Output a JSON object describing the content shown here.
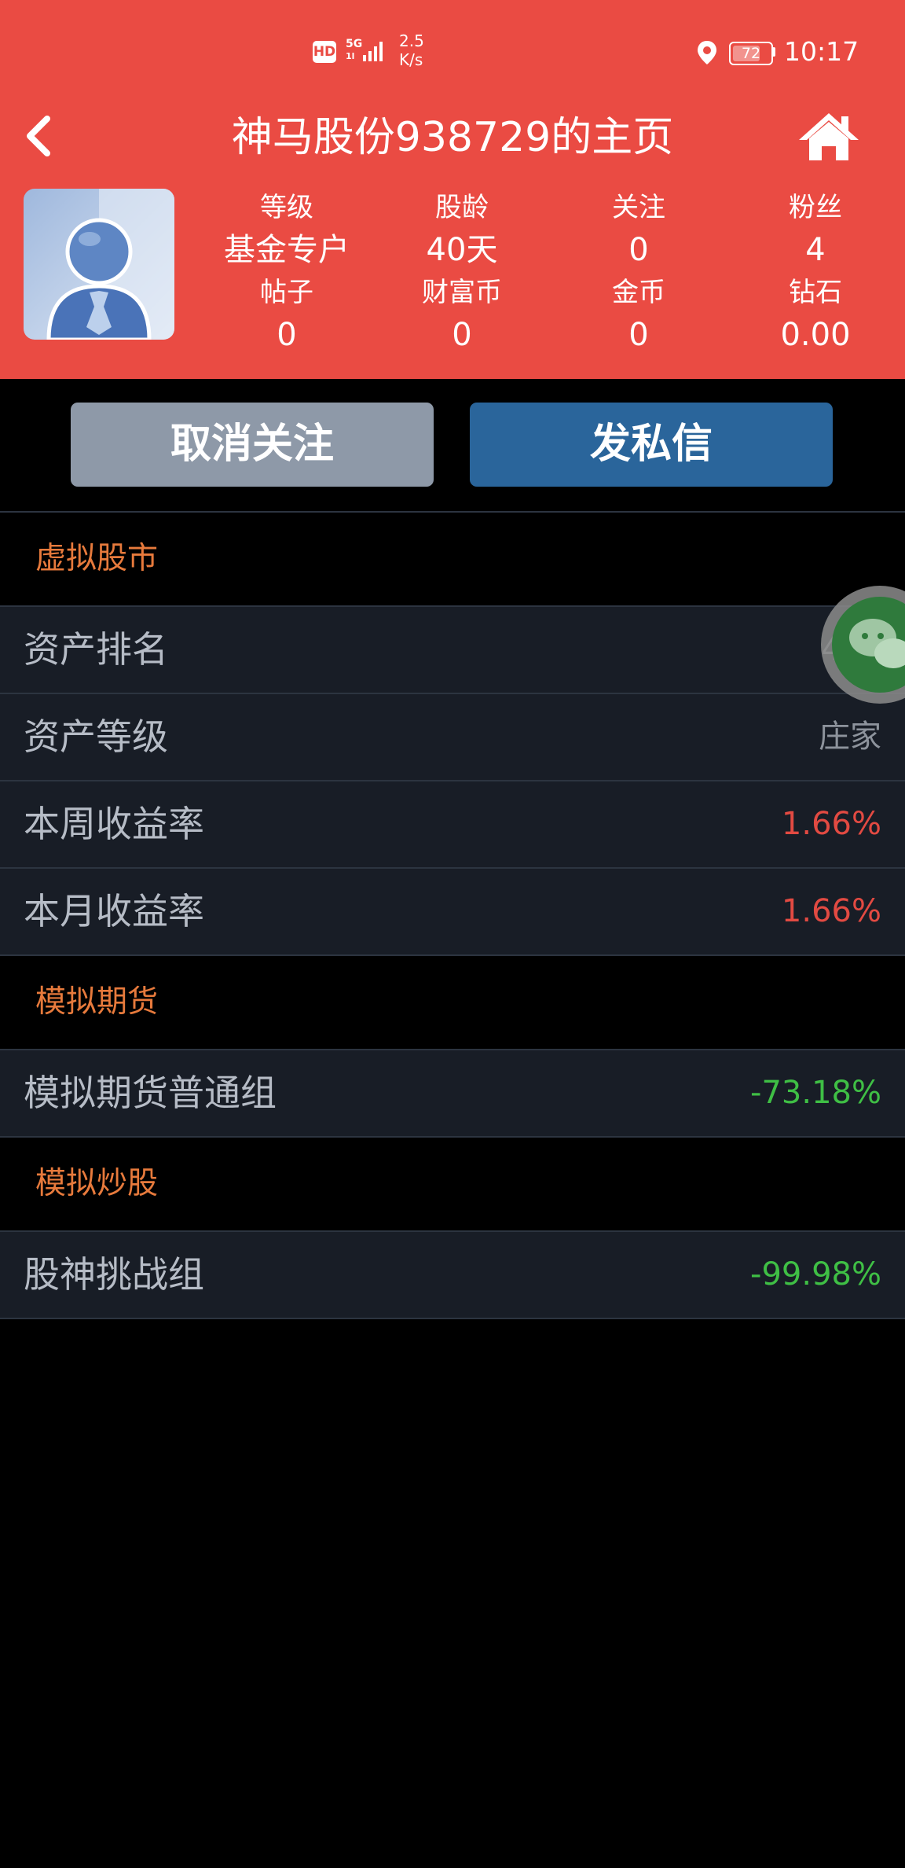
{
  "status_bar": {
    "hd": "HD",
    "network": "5G",
    "network_sub": "1l",
    "speed_value": "2.5",
    "speed_unit": "K/s",
    "battery": "72",
    "time": "10:17"
  },
  "nav": {
    "title": "神马股份938729的主页",
    "back_icon": "chevron-left-icon",
    "home_icon": "home-icon"
  },
  "profile": {
    "stats_row1": [
      {
        "label": "等级",
        "value": "基金专户"
      },
      {
        "label": "股龄",
        "value": "40天"
      },
      {
        "label": "关注",
        "value": "0"
      },
      {
        "label": "粉丝",
        "value": "4"
      }
    ],
    "stats_row2": [
      {
        "label": "帖子",
        "value": "0"
      },
      {
        "label": "财富币",
        "value": "0"
      },
      {
        "label": "金币",
        "value": "0"
      },
      {
        "label": "钻石",
        "value": "0.00"
      }
    ]
  },
  "actions": {
    "unfollow": "取消关注",
    "message": "发私信"
  },
  "sections": [
    {
      "title": "虚拟股市",
      "rows": [
        {
          "label": "资产排名",
          "value": "440",
          "color": "#8d939c"
        },
        {
          "label": "资产等级",
          "value": "庄家",
          "color": "#8d939c"
        },
        {
          "label": "本周收益率",
          "value": "1.66%",
          "color": "#e24a42"
        },
        {
          "label": "本月收益率",
          "value": "1.66%",
          "color": "#e24a42"
        }
      ]
    },
    {
      "title": "模拟期货",
      "rows": [
        {
          "label": "模拟期货普通组",
          "value": "-73.18%",
          "color": "#3fbf45"
        }
      ]
    },
    {
      "title": "模拟炒股",
      "rows": [
        {
          "label": "股神挑战组",
          "value": "-99.98%",
          "color": "#3fbf45"
        }
      ]
    }
  ],
  "floating_button": {
    "icon": "wechat-icon"
  },
  "colors": {
    "header_bg": "#ea4b43",
    "section_title": "#e77a3c",
    "positive": "#e24a42",
    "negative": "#3fbf45",
    "row_bg": "#181d26"
  }
}
